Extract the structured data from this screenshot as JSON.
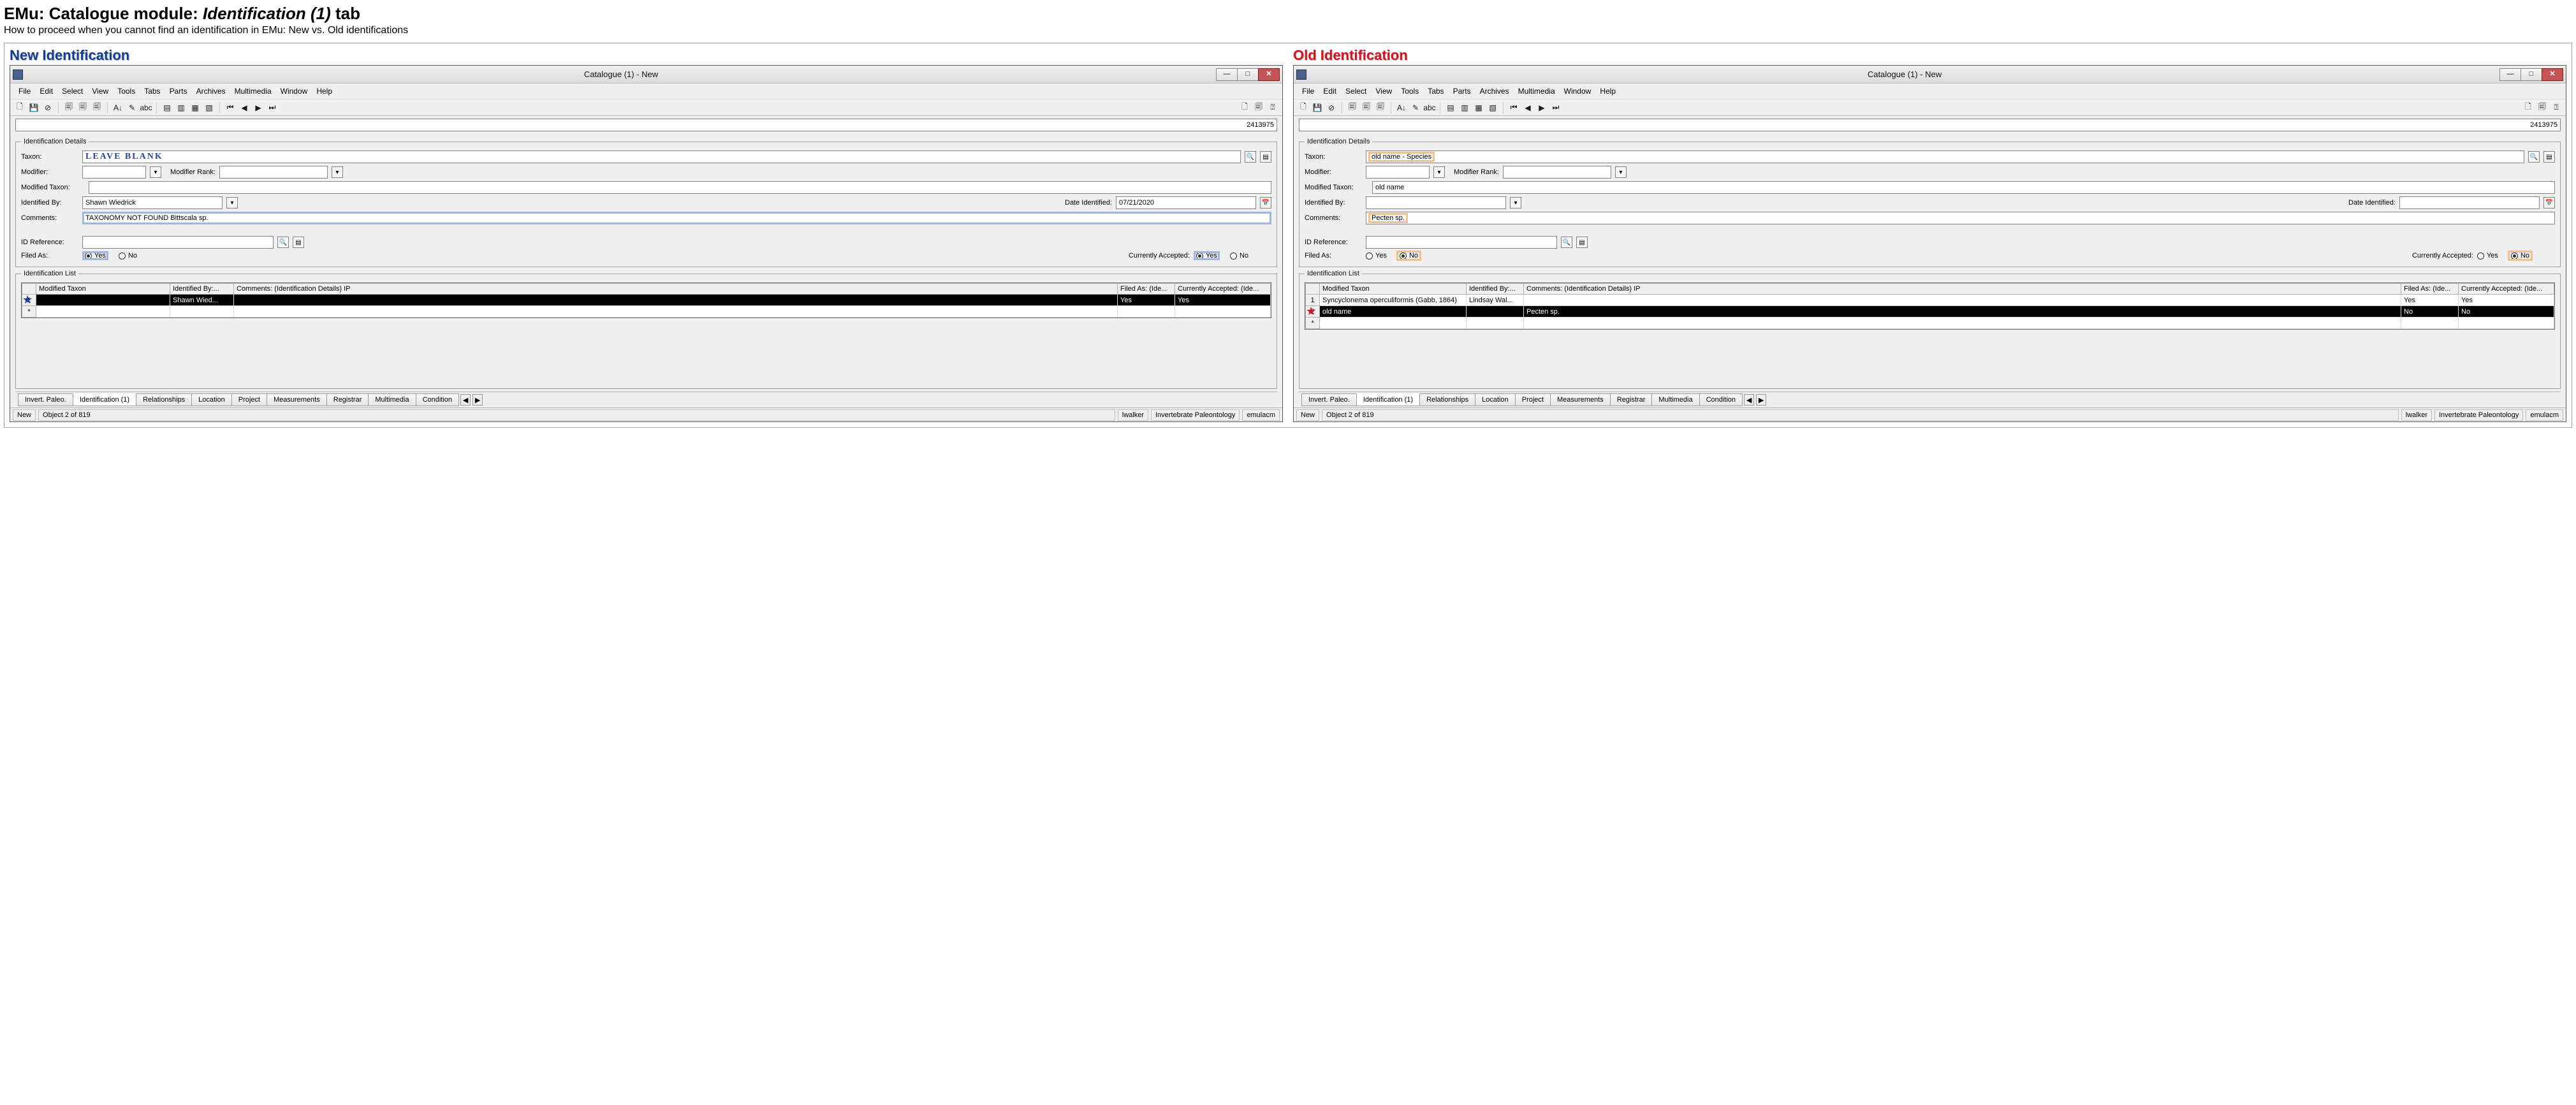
{
  "page": {
    "title_pre": "EMu: Catalogue module: ",
    "title_tab": "Identification (1)",
    "title_post": " tab",
    "subtitle": "How to proceed when you cannot find an identification in EMu: New vs. Old identifications"
  },
  "labels": {
    "new_heading": "New Identification",
    "old_heading": "Old Identification",
    "taxon": "Taxon:",
    "modifier": "Modifier:",
    "modifier_rank": "Modifier Rank:",
    "modified_taxon": "Modified Taxon:",
    "identified_by": "Identified By:",
    "date_identified": "Date Identified:",
    "comments": "Comments:",
    "id_reference": "ID Reference:",
    "filed_as": "Filed As:",
    "currently_accepted": "Currently Accepted:",
    "identification_details": "Identification Details",
    "identification_list": "Identification List",
    "yes": "Yes",
    "no": "No",
    "new": "New"
  },
  "menus": [
    "File",
    "Edit",
    "Select",
    "View",
    "Tools",
    "Tabs",
    "Parts",
    "Archives",
    "Multimedia",
    "Window",
    "Help"
  ],
  "toolbar_groups": [
    [
      "new-doc",
      "save",
      "forbid"
    ],
    [
      "module1",
      "module2",
      "module3"
    ],
    [
      "sort",
      "edit-pencil",
      "abc-check"
    ],
    [
      "sheet1",
      "sheet2",
      "sheet3",
      "sheet4"
    ],
    [
      "nav-first",
      "nav-prev",
      "nav-next",
      "nav-last"
    ]
  ],
  "toolbar_right": [
    "copy-page",
    "paste-page",
    "help-cursor"
  ],
  "icon_glyphs": {
    "new-doc": "🗋",
    "save": "💾",
    "forbid": "⊘",
    "module1": "🗐",
    "module2": "🗐",
    "module3": "🗐",
    "sort": "A↓",
    "edit-pencil": "✎",
    "abc-check": "abc",
    "sheet1": "▤",
    "sheet2": "▥",
    "sheet3": "▦",
    "sheet4": "▧",
    "nav-first": "⏮",
    "nav-prev": "◀",
    "nav-next": "▶",
    "nav-last": "⏭",
    "copy-page": "🗋",
    "paste-page": "🗐",
    "help-cursor": "⍰"
  },
  "bottom_tabs": [
    "Invert. Paleo.",
    "Identification (1)",
    "Relationships",
    "Location",
    "Project",
    "Measurements",
    "Registrar",
    "Multimedia",
    "Condition"
  ],
  "grid_headers": {
    "mod_taxon": "Modified Taxon",
    "ident_by": "Identified By:...",
    "comments": "Comments: (Identification Details) IP",
    "filed_as": "Filed As: (Ide...",
    "curr_acc": "Currently Accepted: (Ide..."
  },
  "new_panel": {
    "window_title": "Catalogue (1) - New",
    "top_id": "2413975",
    "taxon": "LEAVE BLANK",
    "modifier": "",
    "modifier_rank": "",
    "modified_taxon": "",
    "identified_by": "Shawn Wiedrick",
    "date_identified": "07/21/2020",
    "comments": "TAXONOMY NOT FOUND Bittscala sp.",
    "id_reference": "",
    "filed_as": "Yes",
    "currently_accepted": "Yes",
    "grid": [
      {
        "idx": "1",
        "mod_taxon": "",
        "ident_by": "Shawn Wied...",
        "comments": "",
        "filed_as": "Yes",
        "curr_acc": "Yes",
        "selected": true,
        "starred": true
      },
      {
        "idx": "*",
        "mod_taxon": "",
        "ident_by": "",
        "comments": "",
        "filed_as": "",
        "curr_acc": "",
        "selected": false
      }
    ],
    "status_mode": "New",
    "status_obj": "Object 2 of 819",
    "status_user": "lwalker",
    "status_dept": "Invertebrate Paleontology",
    "status_env": "emulacm"
  },
  "old_panel": {
    "window_title": "Catalogue (1) - New",
    "top_id": "2413975",
    "taxon": "old name - Species",
    "modifier": "",
    "modifier_rank": "",
    "modified_taxon": "old name",
    "identified_by": "",
    "date_identified": "",
    "comments": "Pecten sp.",
    "id_reference": "",
    "filed_as": "No",
    "currently_accepted": "No",
    "grid": [
      {
        "idx": "1",
        "mod_taxon": "Syncyclonema operculiformis (Gabb, 1864)",
        "ident_by": "Lindsay Wal...",
        "comments": "",
        "filed_as": "Yes",
        "curr_acc": "Yes",
        "selected": false
      },
      {
        "idx": "2",
        "mod_taxon": "old name",
        "ident_by": "",
        "comments": "Pecten sp.",
        "filed_as": "No",
        "curr_acc": "No",
        "selected": true,
        "starred": true
      },
      {
        "idx": "*",
        "mod_taxon": "",
        "ident_by": "",
        "comments": "",
        "filed_as": "",
        "curr_acc": "",
        "selected": false
      }
    ],
    "status_mode": "New",
    "status_obj": "Object 2 of 819",
    "status_user": "lwalker",
    "status_dept": "Invertebrate Paleontology",
    "status_env": "emulacm"
  }
}
